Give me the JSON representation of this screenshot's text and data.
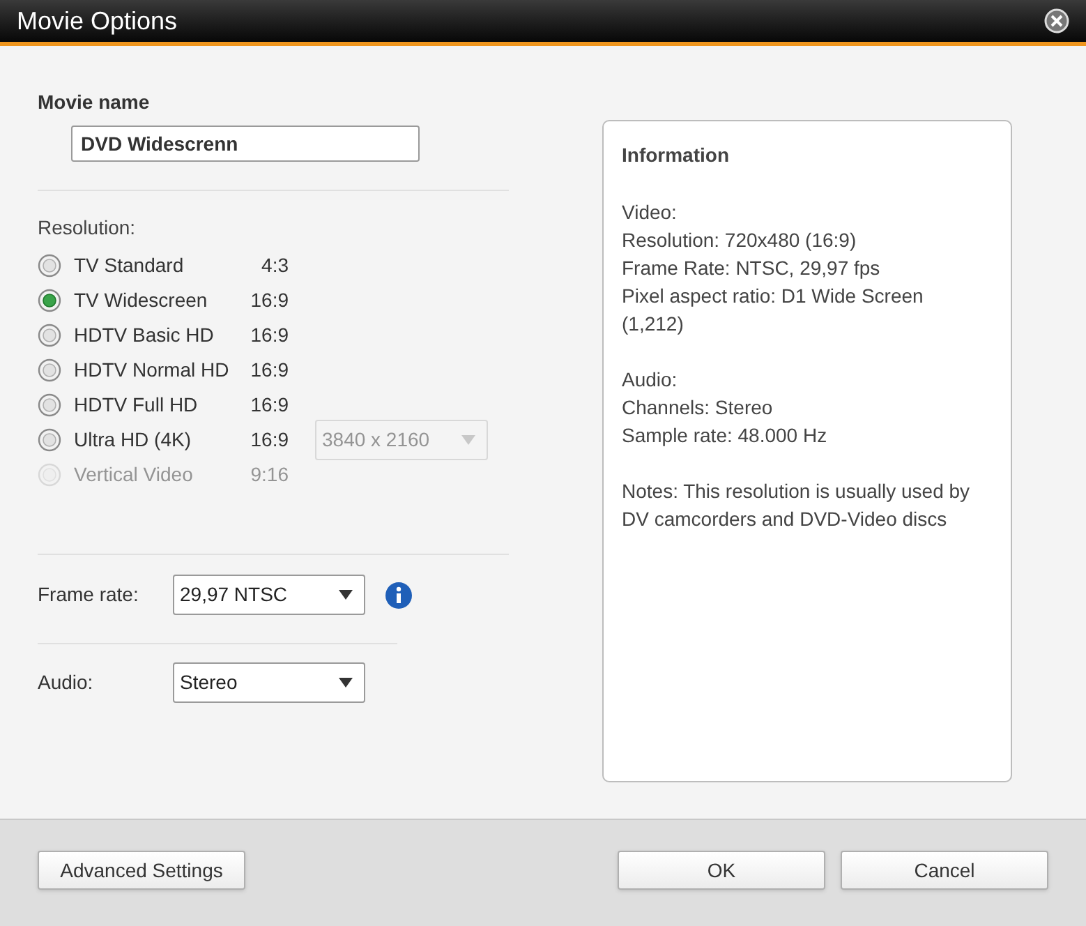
{
  "window": {
    "title": "Movie Options"
  },
  "movie_name": {
    "label": "Movie name",
    "value": "DVD Widescrenn"
  },
  "resolution": {
    "label": "Resolution:",
    "options": [
      {
        "label": "TV Standard",
        "ratio": "4:3",
        "selected": false,
        "disabled": false
      },
      {
        "label": "TV Widescreen",
        "ratio": "16:9",
        "selected": true,
        "disabled": false
      },
      {
        "label": "HDTV Basic HD",
        "ratio": "16:9",
        "selected": false,
        "disabled": false
      },
      {
        "label": "HDTV Normal HD",
        "ratio": "16:9",
        "selected": false,
        "disabled": false
      },
      {
        "label": "HDTV Full HD",
        "ratio": "16:9",
        "selected": false,
        "disabled": false
      },
      {
        "label": "Ultra HD (4K)",
        "ratio": "16:9",
        "selected": false,
        "disabled": false,
        "size_select": {
          "value": "3840 x 2160",
          "disabled": true
        }
      },
      {
        "label": "Vertical Video",
        "ratio": "9:16",
        "selected": false,
        "disabled": true
      }
    ]
  },
  "frame_rate": {
    "label": "Frame rate:",
    "value": "29,97 NTSC"
  },
  "audio": {
    "label": "Audio:",
    "value": "Stereo"
  },
  "information": {
    "title": "Information",
    "sections": [
      [
        "Video:",
        "Resolution: 720x480 (16:9)",
        "Frame Rate: NTSC, 29,97 fps",
        "Pixel aspect ratio: D1 Wide Screen (1,212)"
      ],
      [
        "Audio:",
        "Channels: Stereo",
        "Sample rate: 48.000 Hz"
      ],
      [
        "Notes: This resolution is usually used by DV camcorders and DVD-Video discs"
      ]
    ]
  },
  "buttons": {
    "advanced": "Advanced Settings",
    "ok": "OK",
    "cancel": "Cancel"
  }
}
